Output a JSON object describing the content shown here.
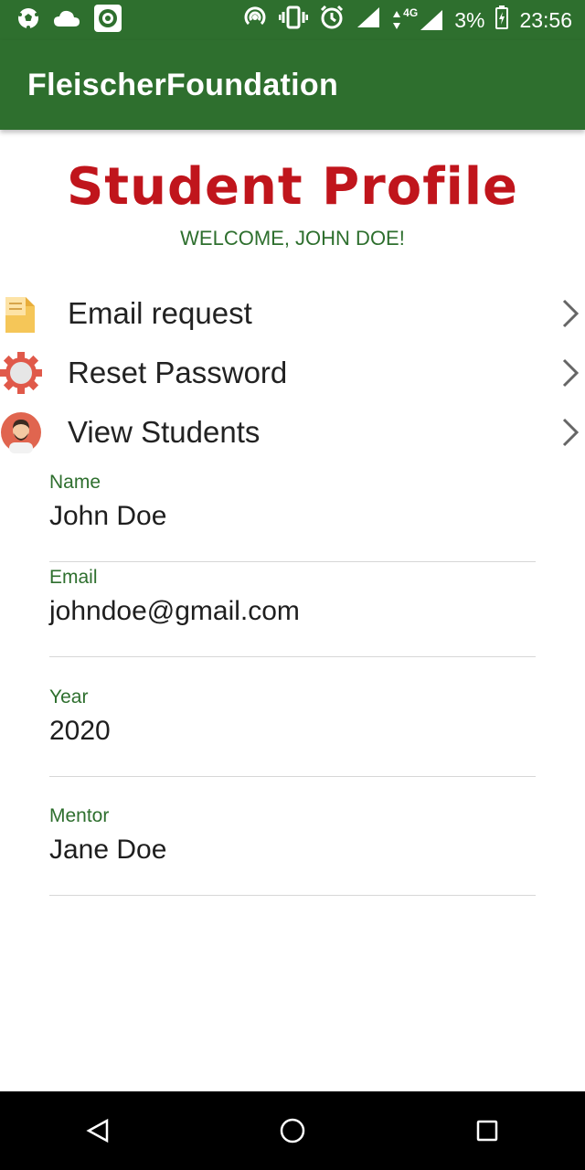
{
  "status_bar": {
    "battery": "3%",
    "time": "23:56",
    "network": "4G",
    "icons_left": [
      "soccer-ball-icon",
      "cloud-icon",
      "target-icon"
    ],
    "icons_right": [
      "hotspot-icon",
      "vibrate-icon",
      "alarm-icon",
      "signal-icon",
      "battery-icon"
    ]
  },
  "app_bar": {
    "title": "FleischerFoundation",
    "color": "#2e6f2e"
  },
  "header": {
    "title": "Student Profile",
    "welcome": "WELCOME, JOHN DOE!",
    "title_color": "#c0151c"
  },
  "menu": [
    {
      "label": "Email request",
      "icon": "document-icon"
    },
    {
      "label": "Reset Password",
      "icon": "gear-icon"
    },
    {
      "label": "View Students",
      "icon": "avatar-icon"
    }
  ],
  "profile": {
    "fields": [
      {
        "label": "Name",
        "value": "John Doe"
      },
      {
        "label": "Email",
        "value": "johndoe@gmail.com"
      },
      {
        "label": "Year",
        "value": "2020"
      },
      {
        "label": "Mentor",
        "value": "Jane Doe"
      }
    ]
  },
  "nav_bar": {
    "buttons": [
      "back-icon",
      "home-icon",
      "recents-icon"
    ]
  }
}
